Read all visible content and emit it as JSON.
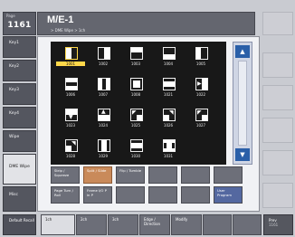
{
  "page": {
    "label": "Page",
    "number": "1161"
  },
  "header": {
    "title": "M/E-1",
    "subtitle": "> DME Wipe > 1ch"
  },
  "nav": [
    "Key1",
    "Key2",
    "Key3",
    "Key4",
    "Wipe",
    "DME Wipe",
    "Misc"
  ],
  "patterns": [
    "1001",
    "1002",
    "1003",
    "1004",
    "1005",
    "1006",
    "1007",
    "1008",
    "1021",
    "1022",
    "1023",
    "1024",
    "1025",
    "1026",
    "1027",
    "1028",
    "1029",
    "1030",
    "1031"
  ],
  "selected_pattern": "1001",
  "category_row1": [
    "Strip / Squeeze",
    "Split / Slide",
    "Flip / Tumble",
    "",
    "",
    ""
  ],
  "category_row2": [
    "Page Turn / Roll",
    "Frame I/O P in P",
    "",
    "",
    "",
    "User Program"
  ],
  "bottom_tabs": [
    "1ch",
    "2ch",
    "3ch",
    "Edge / Direction",
    "Modify"
  ],
  "default_recall": "Default Recall",
  "prev": {
    "label": "Prev",
    "page": "1161"
  },
  "scroll": {
    "up": "▲",
    "down": "▼"
  }
}
